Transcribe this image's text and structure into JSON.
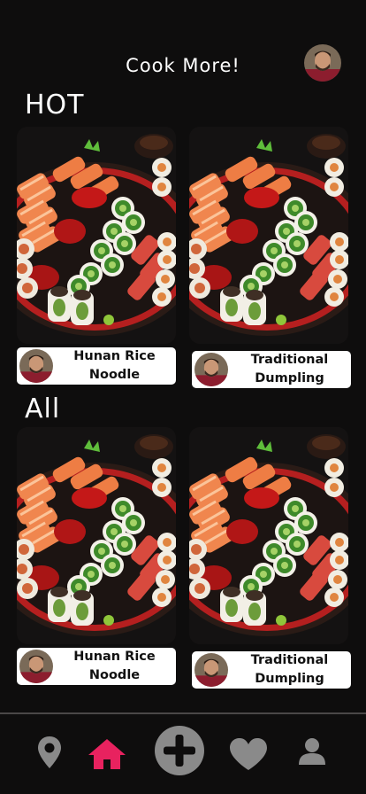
{
  "header": {
    "title": "Cook More!"
  },
  "sections": {
    "hot": {
      "title": "HOT"
    },
    "all": {
      "title": "All"
    }
  },
  "cards": {
    "hot": [
      {
        "name": "Hunan Rice\nNoodle"
      },
      {
        "name": "Traditional\nDumpling"
      }
    ],
    "all": [
      {
        "name": "Hunan Rice\nNoodle"
      },
      {
        "name": "Traditional\nDumpling"
      }
    ]
  },
  "nav": {
    "items": [
      {
        "icon": "location-pin-icon",
        "active": false
      },
      {
        "icon": "home-icon",
        "active": true
      },
      {
        "icon": "plus-circle-icon",
        "active": false
      },
      {
        "icon": "heart-icon",
        "active": false
      },
      {
        "icon": "user-icon",
        "active": false
      }
    ]
  },
  "colors": {
    "background": "#0e0d0d",
    "accent": "#e8225f",
    "icon_gray": "#8a8a8a"
  }
}
